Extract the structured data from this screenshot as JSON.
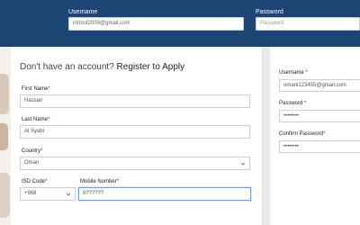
{
  "header": {
    "username_label": "Username",
    "username_value": "mtmot2009@gmail.com",
    "password_label": "Password",
    "password_placeholder": "Password"
  },
  "register": {
    "heading_prefix": "Don't have an account?",
    "heading_link": "Register to Apply",
    "first_name_label": "First Name",
    "first_name_value": "Hassan",
    "last_name_label": "Last Name",
    "last_name_value": "Al Syabi",
    "country_label": "Country",
    "country_value": "Oman",
    "isd_label": "ISD Code",
    "isd_value": "+968",
    "mobile_label": "Mobile Number",
    "mobile_value": "9??????",
    "required_mark": "*"
  },
  "account": {
    "username_label": "Username",
    "username_value": "omani123455@gmail.com",
    "password_label": "Password",
    "password_value": "••••••••",
    "confirm_label": "Confirm Password",
    "confirm_value": "••••••••",
    "required_mark": "*"
  },
  "colors": {
    "header_bg": "#1d4574",
    "required": "#d0021b",
    "focus": "#6aa5e3"
  }
}
